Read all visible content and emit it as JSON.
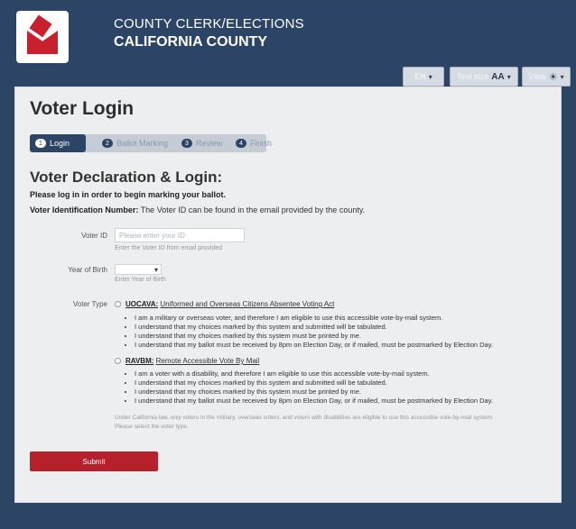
{
  "header": {
    "line1": "COUNTY CLERK/ELECTIONS",
    "line2": "CALIFORNIA COUNTY",
    "lang_label": "EN",
    "textsize_label": "Text size",
    "textsize_glyph": "AA",
    "view_label": "View",
    "caret": "▾",
    "sun": "☀",
    "logo_icon": "ballot-box-icon"
  },
  "page": {
    "title": "Voter Login",
    "heading": "Voter Declaration & Login:",
    "instruction": "Please log in in order to begin marking your ballot.",
    "vid_label": "Voter Identification Number:",
    "vid_text": " The Voter ID can be found in the email provided by the county."
  },
  "steps": [
    {
      "num": "1",
      "label": "Login"
    },
    {
      "num": "2",
      "label": "Ballot Marking"
    },
    {
      "num": "3",
      "label": "Review"
    },
    {
      "num": "4",
      "label": "Finish"
    }
  ],
  "form": {
    "voter_id_label": "Voter ID",
    "voter_id_placeholder": "Please enter your ID",
    "voter_id_help": "Enter the Voter ID from email provided",
    "yob_label": "Year of Birth",
    "yob_value": "",
    "yob_help": "Enter Year of Birth",
    "voter_type_label": "Voter Type",
    "options": [
      {
        "code": "UOCAVA:",
        "name": "Uniformed and Overseas Citizens Absentee Voting Act",
        "bullets": [
          "I am a military or overseas voter, and therefore I am eligible to use this accessible vote-by-mail system.",
          "I understand that my choices marked by this system and submitted will be tabulated.",
          "I understand that my choices marked by this system must be printed by me.",
          "I understand that my ballot must be received by 8pm on Election Day, or if mailed, must be postmarked by Election Day."
        ]
      },
      {
        "code": "RAVBM:",
        "name": "Remote Accessible Vote By Mail",
        "bullets": [
          "I am a voter with a disability, and therefore I am eligible to use this accessible vote-by-mail system.",
          "I understand that my choices marked by this system and submitted will be tabulated.",
          "I understand that my choices marked by this system must be printed by me.",
          "I understand that my ballot must be received by 8pm on Election Day, or if mailed, must be postmarked by Election Day."
        ]
      }
    ],
    "note1": "Under California law, only voters in the military, overseas voters, and voters with disabilities are eligible to use this accessible vote-by-mail system.",
    "note2": "Please select the voter type.",
    "submit_label": "Submit"
  }
}
